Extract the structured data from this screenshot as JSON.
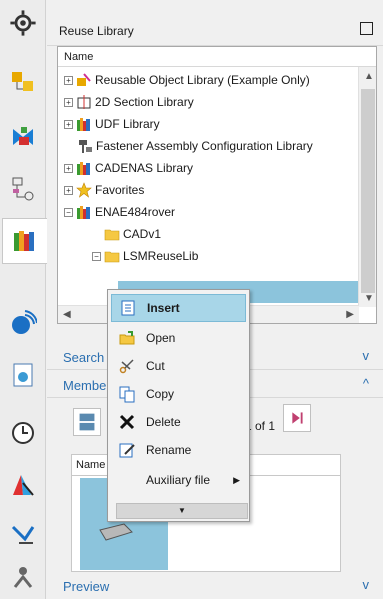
{
  "panel": {
    "title": "Reuse Library",
    "tree_header": "Name",
    "tree_items": [
      {
        "label": "Reusable Object Library (Example Only)",
        "expander": "+",
        "icon": "reusable-object-icon"
      },
      {
        "label": "2D Section Library",
        "expander": "+",
        "icon": "section-icon"
      },
      {
        "label": "UDF Library",
        "expander": "+",
        "icon": "books-icon"
      },
      {
        "label": "Fastener Assembly Configuration Library",
        "expander": "",
        "icon": "fastener-icon"
      },
      {
        "label": "CADENAS Library",
        "expander": "+",
        "icon": "books-icon"
      },
      {
        "label": "Favorites",
        "expander": "+",
        "icon": "star-icon"
      },
      {
        "label": "ENAE484rover",
        "expander": "−",
        "icon": "books-icon"
      },
      {
        "label": "CADv1",
        "expander": "",
        "icon": "folder-icon"
      },
      {
        "label": "LSMReuseLib",
        "expander": "−",
        "icon": "folder-icon"
      }
    ]
  },
  "sections": {
    "search": "Search",
    "members": "Members",
    "preview": "Preview"
  },
  "members": {
    "page_text": "1 of 1",
    "name_column": "Name"
  },
  "context_menu": {
    "items": [
      {
        "label": "Insert",
        "icon": "insert-icon"
      },
      {
        "label": "Open",
        "icon": "open-icon"
      },
      {
        "label": "Cut",
        "icon": "scissors-icon"
      },
      {
        "label": "Copy",
        "icon": "copy-icon"
      },
      {
        "label": "Delete",
        "icon": "delete-icon"
      },
      {
        "label": "Rename",
        "icon": "rename-icon"
      },
      {
        "label": "Auxiliary file",
        "icon": ""
      }
    ],
    "more": "▼"
  },
  "colors": {
    "selection": "#8cc4dc",
    "menu_highlight": "#a8d6e8",
    "section_text": "#2b6fb0"
  }
}
